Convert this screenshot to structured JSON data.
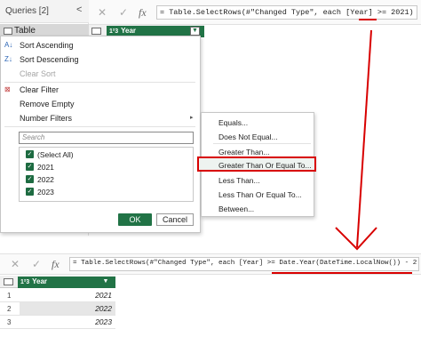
{
  "queries": {
    "title": "Queries [2]",
    "collapse_glyph": "<",
    "items": [
      {
        "label": "Table"
      }
    ]
  },
  "top": {
    "formula": "= Table.SelectRows(#\"Changed Type\", each [Year] >= 2021)",
    "cancel_glyph": "✕",
    "commit_glyph": "✓",
    "fx": "fx",
    "column_header": "Year",
    "type_glyph": "1²3"
  },
  "dropdown": {
    "sort_ascending": "Sort Ascending",
    "sort_descending": "Sort Descending",
    "clear_sort": "Clear Sort",
    "clear_filter": "Clear Filter",
    "remove_empty": "Remove Empty",
    "number_filters": "Number Filters",
    "search_placeholder": "Search",
    "list": [
      {
        "label": "(Select All)",
        "checked": true
      },
      {
        "label": "2021",
        "checked": true
      },
      {
        "label": "2022",
        "checked": true
      },
      {
        "label": "2023",
        "checked": true
      }
    ],
    "ok": "OK",
    "cancel": "Cancel"
  },
  "submenu": {
    "items": [
      {
        "label": "Equals..."
      },
      {
        "label": "Does Not Equal..."
      },
      {
        "label": "Greater Than..."
      },
      {
        "label": "Greater Than Or Equal To..."
      },
      {
        "label": "Less Than..."
      },
      {
        "label": "Less Than Or Equal To..."
      },
      {
        "label": "Between..."
      }
    ]
  },
  "bottom": {
    "formula": "= Table.SelectRows(#\"Changed Type\", each [Year] >= Date.Year(DateTime.LocalNow()) - 2 )",
    "cancel_glyph": "✕",
    "commit_glyph": "✓",
    "fx": "fx",
    "column_header": "Year",
    "type_glyph": "1²3",
    "rows": [
      {
        "n": "1",
        "year": "2021"
      },
      {
        "n": "2",
        "year": "2022"
      },
      {
        "n": "3",
        "year": "2023"
      }
    ]
  },
  "colors": {
    "accent_green": "#217346",
    "annotation_red": "#d80000"
  }
}
